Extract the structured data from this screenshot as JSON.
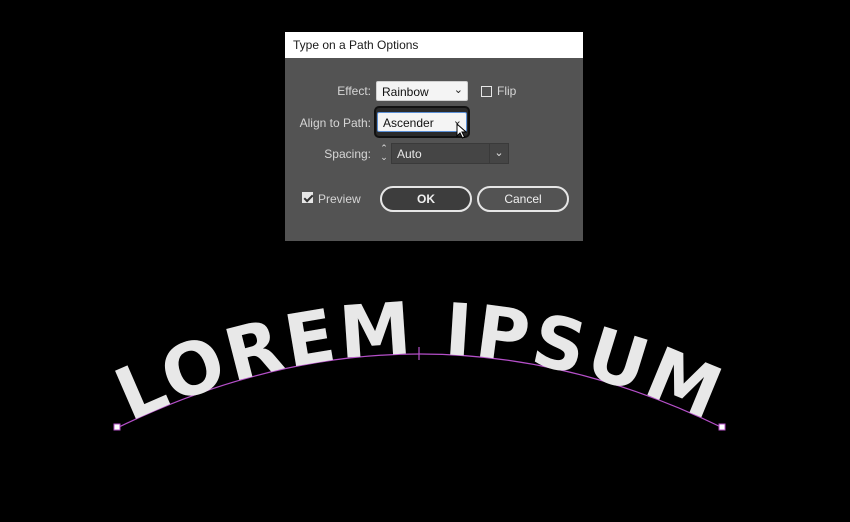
{
  "dialog": {
    "title": "Type on a Path Options",
    "effect": {
      "label": "Effect:",
      "value": "Rainbow"
    },
    "flip": {
      "label": "Flip",
      "checked": false
    },
    "align_to_path": {
      "label": "Align to Path:",
      "value": "Ascender"
    },
    "spacing": {
      "label": "Spacing:",
      "value": "Auto"
    },
    "preview": {
      "label": "Preview",
      "checked": true
    },
    "buttons": {
      "ok": "OK",
      "cancel": "Cancel"
    }
  },
  "artwork": {
    "text": "LOREM IPSUM",
    "text_color": "#e8e8e8",
    "path_color": "#b54fc9",
    "background_color": "#000000"
  }
}
